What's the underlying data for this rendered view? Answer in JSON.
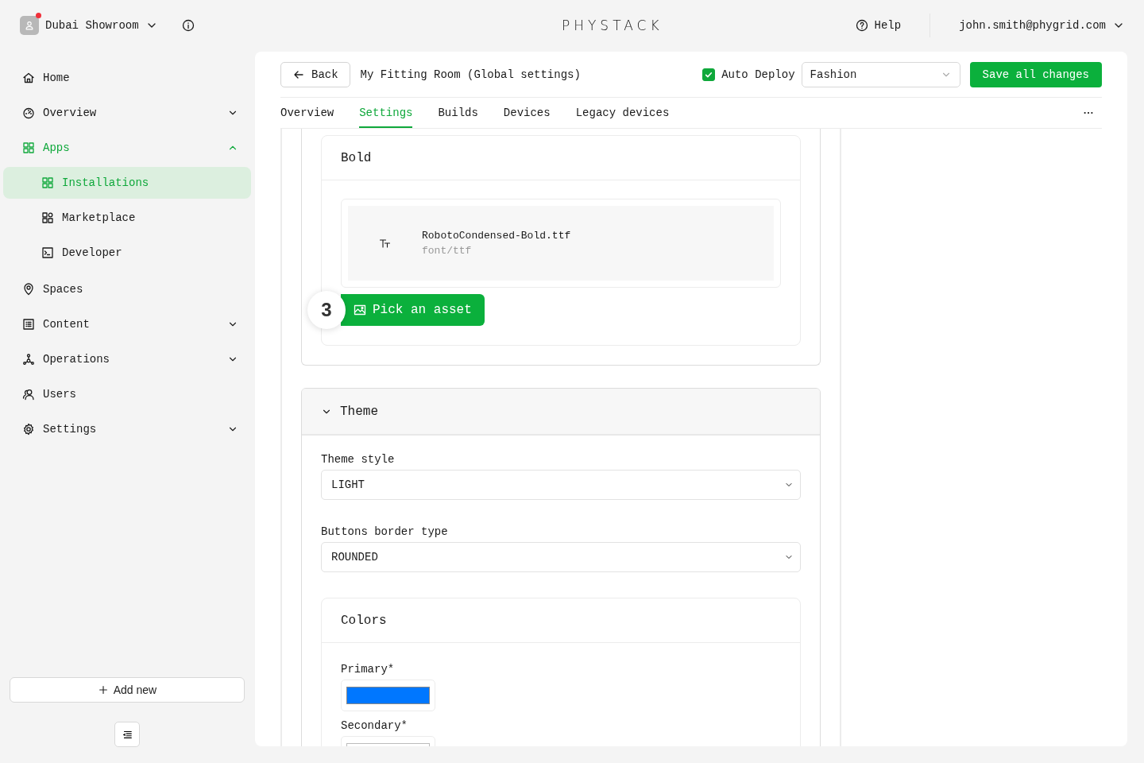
{
  "topbar": {
    "workspace": "Dubai Showroom",
    "notification": true,
    "logo": "PHYSTACK",
    "help": "Help",
    "user": "john.smith@phygrid.com"
  },
  "sidebar": {
    "items": [
      {
        "label": "Home",
        "selected": false
      },
      {
        "label": "Overview",
        "selected": false,
        "expanded": false
      },
      {
        "label": "Apps",
        "selected": true,
        "expanded": true,
        "children": [
          {
            "label": "Installations",
            "selected": true
          },
          {
            "label": "Marketplace",
            "selected": false
          },
          {
            "label": "Developer",
            "selected": false
          }
        ]
      },
      {
        "label": "Spaces",
        "selected": false
      },
      {
        "label": "Content",
        "selected": false,
        "expanded": false
      },
      {
        "label": "Operations",
        "selected": false,
        "expanded": false
      },
      {
        "label": "Users",
        "selected": false
      },
      {
        "label": "Settings",
        "selected": false,
        "expanded": false
      }
    ],
    "add_button": "Add new"
  },
  "header": {
    "back": "Back",
    "title": "My Fitting Room (Global settings)",
    "auto_deploy": {
      "label": "Auto Deploy",
      "checked": true
    },
    "dropdown": "Fashion",
    "save": "Save all changes"
  },
  "tabs": [
    {
      "label": "Overview",
      "selected": false
    },
    {
      "label": "Settings",
      "selected": true
    },
    {
      "label": "Builds",
      "selected": false
    },
    {
      "label": "Devices",
      "selected": false
    },
    {
      "label": "Legacy devices",
      "selected": false
    }
  ],
  "font_card": {
    "title": "Bold",
    "file_name": "RobotoCondensed-Bold.ttf",
    "file_type": "font/ttf",
    "step": "3",
    "pick_button": "Pick an asset"
  },
  "theme": {
    "title": "Theme",
    "expanded": true,
    "fields": [
      {
        "label": "Theme style",
        "value": "LIGHT"
      },
      {
        "label": "Buttons border type",
        "value": "ROUNDED"
      }
    ],
    "colors": {
      "title": "Colors",
      "items": [
        {
          "label": "Primary*",
          "color": "#0077ff"
        },
        {
          "label": "Secondary*"
        }
      ]
    }
  }
}
